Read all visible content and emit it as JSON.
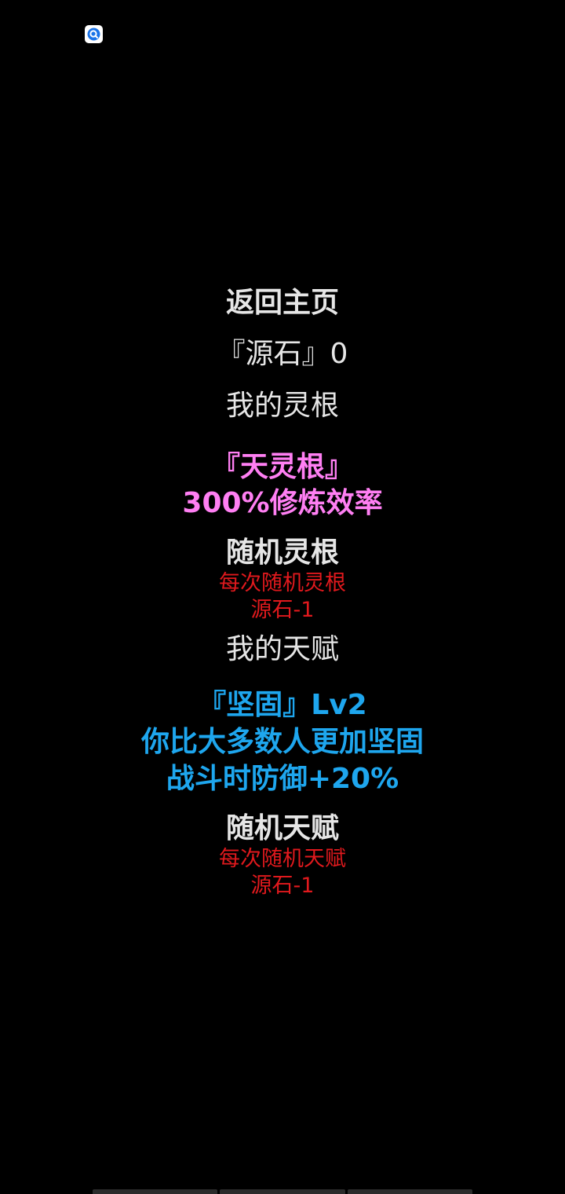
{
  "status_bar": {
    "app_icon": "q-search-icon",
    "accent": "#1a73e8"
  },
  "menu": {
    "back_home": "返回主页",
    "source_stone": "『源石』0",
    "my_root_title": "我的灵根",
    "root": {
      "name": "『天灵根』",
      "effect": "300%修炼效率",
      "color": "#ff7ff3"
    },
    "random_root": {
      "label": "随机灵根",
      "desc": "每次随机灵根",
      "cost": "源石-1"
    },
    "my_talent_title": "我的天赋",
    "talent": {
      "name": "『坚固』Lv2",
      "desc": "你比大多数人更加坚固",
      "effect": "战斗时防御+20%",
      "color": "#1ea6ee"
    },
    "random_talent": {
      "label": "随机天赋",
      "desc": "每次随机天赋",
      "cost": "源石-1"
    }
  },
  "colors": {
    "background": "#000000",
    "text": "#e6e6e6",
    "cost": "#e0191d"
  }
}
